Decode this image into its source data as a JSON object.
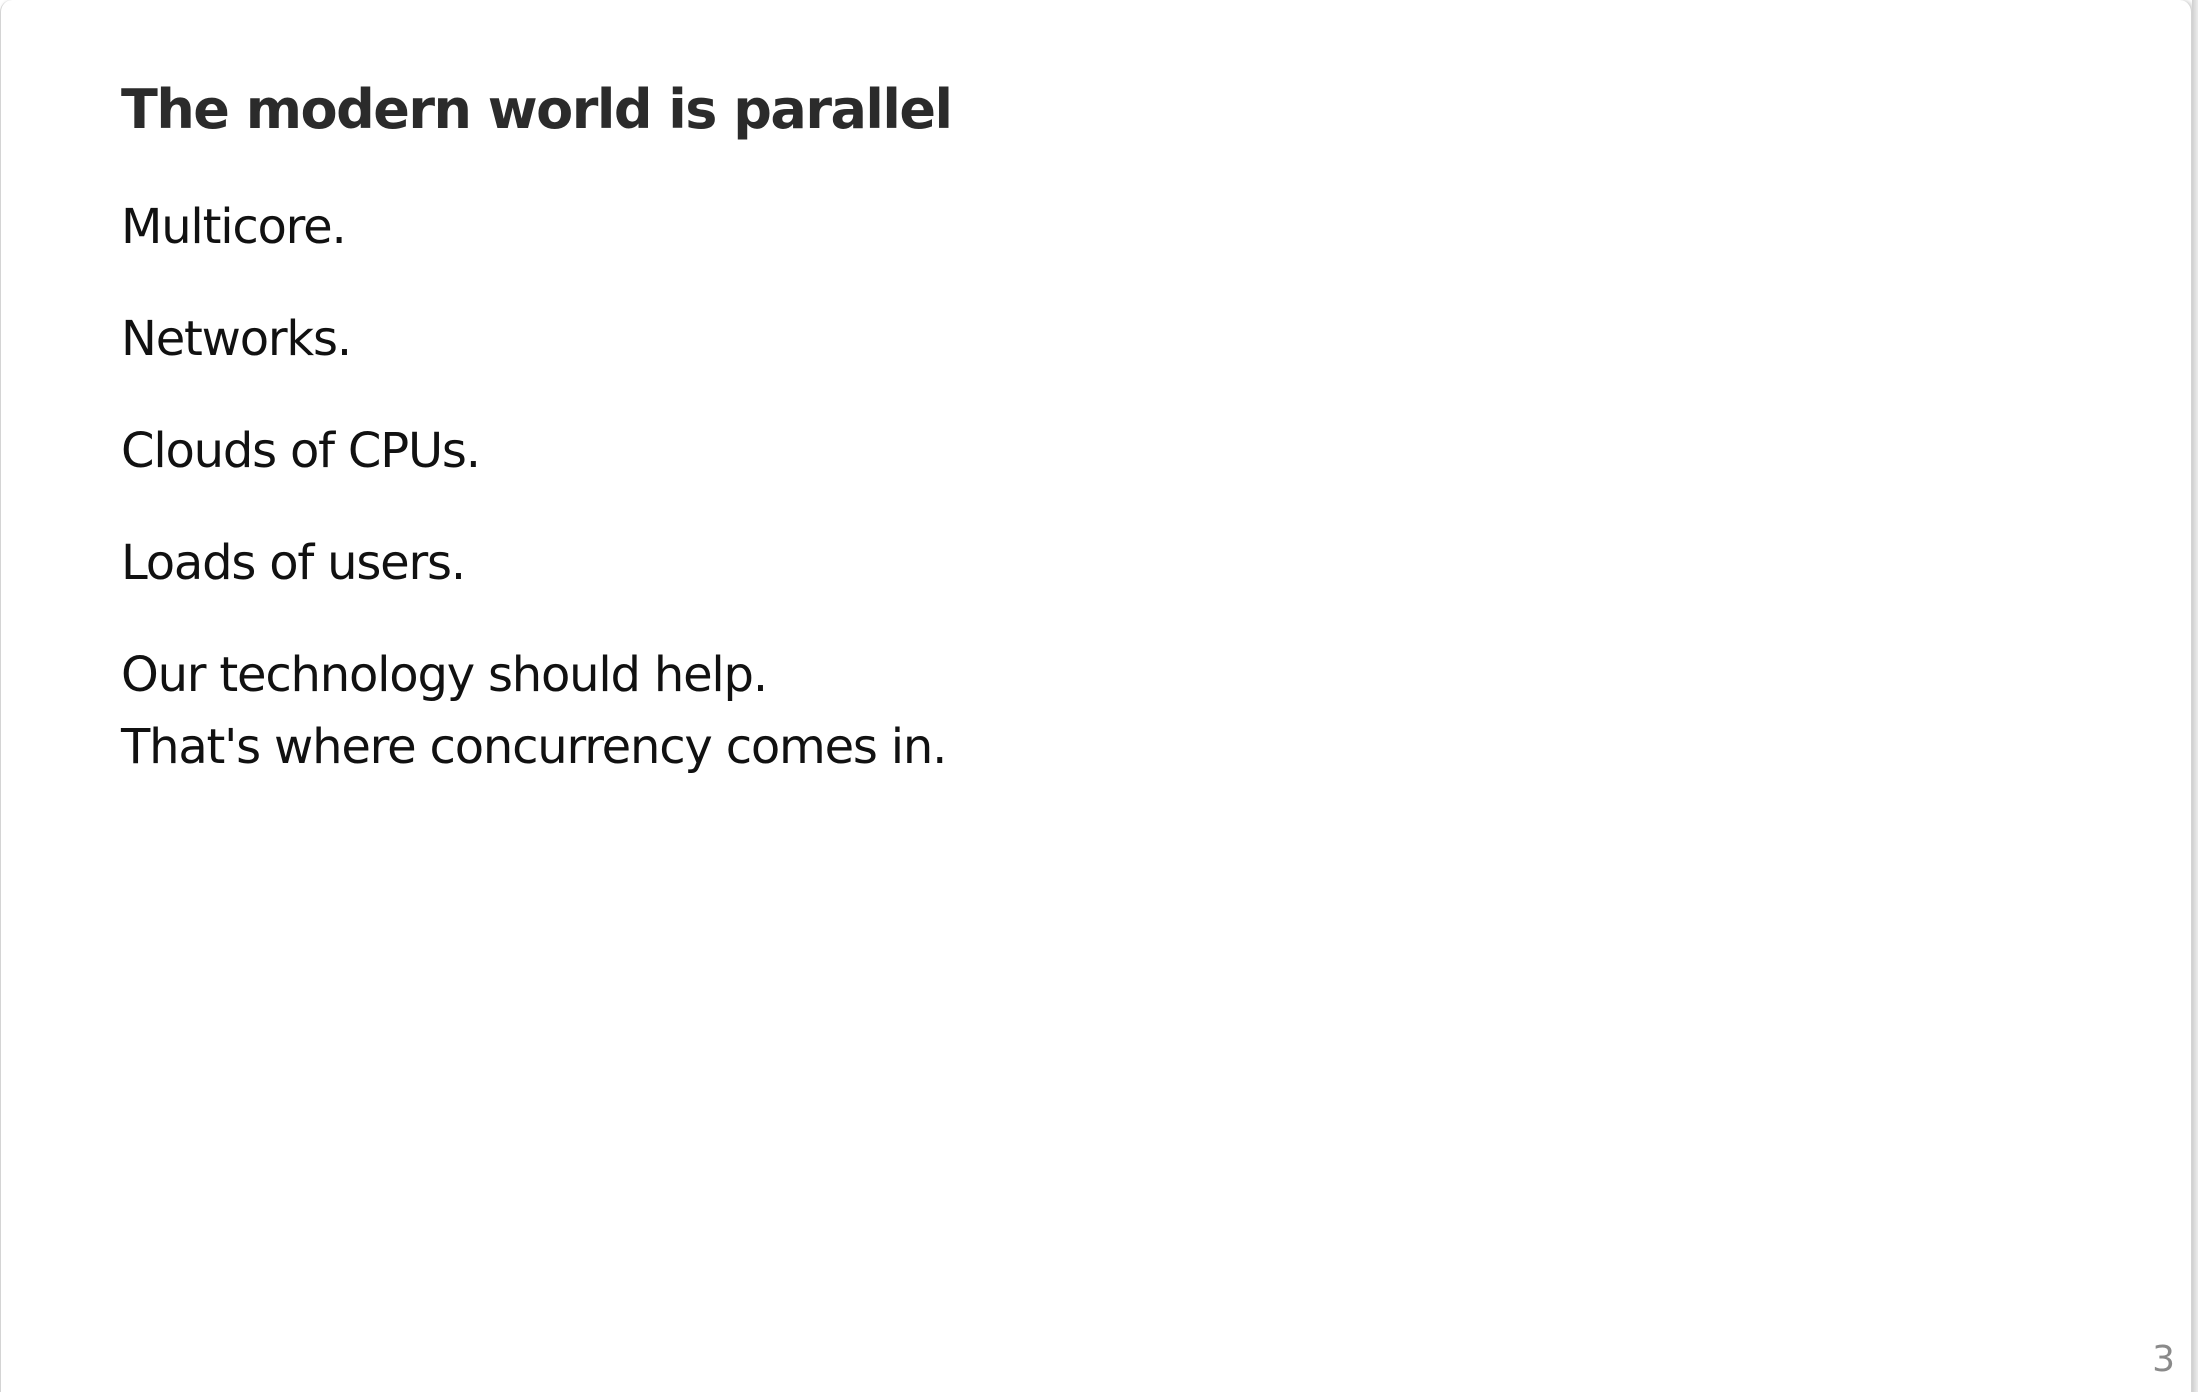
{
  "slide": {
    "title": "The modern world is parallel",
    "lines": [
      "Multicore.",
      "Networks.",
      "Clouds of CPUs.",
      "Loads of users.",
      "Our technology should help.",
      "That's where concurrency comes in."
    ],
    "page_number": "3"
  }
}
